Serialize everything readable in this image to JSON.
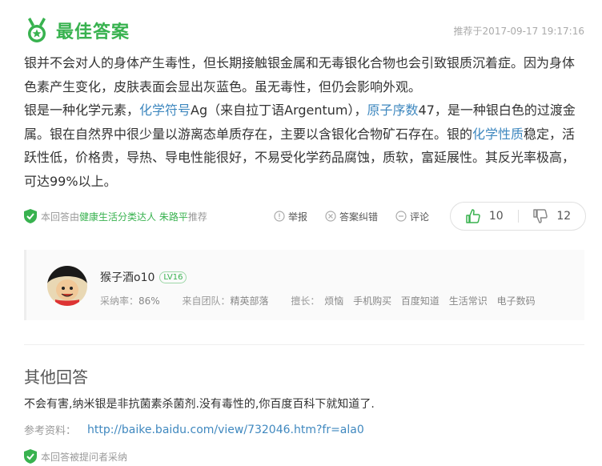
{
  "best": {
    "title": "最佳答案",
    "recommend_time": "推荐于2017-09-17 19:17:16",
    "para1": "银并不会对人的身体产生毒性，但长期接触银金属和无毒银化合物也会引致银质沉着症。因为身体色素产生变化，皮肤表面会显出灰蓝色。虽无毒性，但仍会影响外观。",
    "para2_a": "银是一种化学元素，",
    "link1": "化学符号",
    "para2_b": "Ag（来自拉丁语Argentum），",
    "link2": "原子序数",
    "para2_c": "47，是一种银白色的过渡金属。银在自然界中很少量以游离态单质存在，主要以含银化合物矿石存在。银的",
    "link3": "化学性质",
    "para2_d": "稳定，活跃性低，价格贵，导热、导电性能很好，不易受化学药品腐蚀，质软，富延展性。其反光率极高，可达99%以上。"
  },
  "meta": {
    "by_prefix": "本回答由",
    "recommender": "健康生活分类达人 朱路平",
    "by_suffix": "推荐",
    "report": "举报",
    "correct": "答案纠错",
    "comment": "评论",
    "likes": "10",
    "dislikes": "12"
  },
  "author": {
    "name": "猴子酒o10",
    "level": "LV16",
    "adopt_label": "采纳率：",
    "adopt_rate": "86%",
    "team_label": "来自团队：",
    "team": "精英部落",
    "skills_label": "擅长：",
    "skills": [
      "烦恼",
      "手机购买",
      "百度知道",
      "生活常识",
      "电子数码"
    ]
  },
  "other": {
    "title": "其他回答",
    "text": "不会有害,纳米银是非抗菌素杀菌剂.没有毒性的,你百度百科下就知道了.",
    "ref_label": "参考资料：",
    "ref_link": "http://baike.baidu.com/view/732046.htm?fr=ala0",
    "adopted": "本回答被提问者采纳"
  },
  "colors": {
    "accent_green": "#38b24f",
    "link_blue": "#3f88bf"
  }
}
